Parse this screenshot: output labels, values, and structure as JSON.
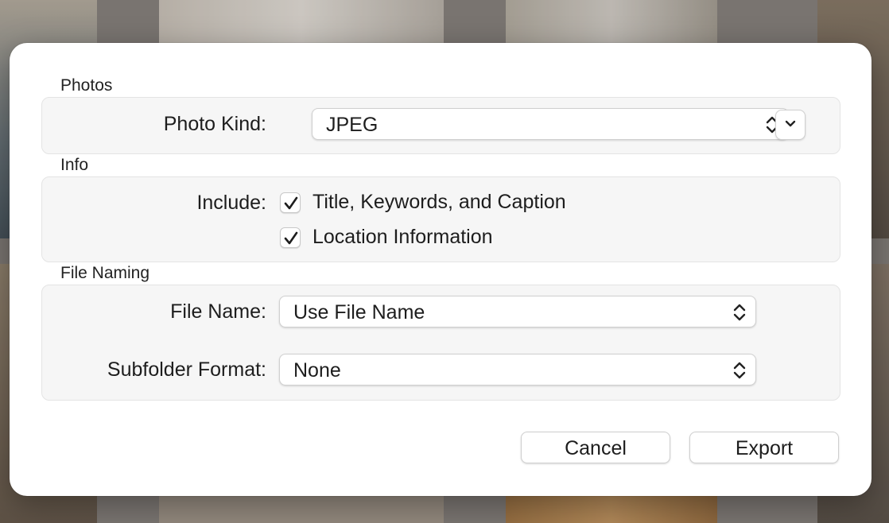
{
  "dialog": {
    "sections": {
      "photos": {
        "title": "Photos",
        "photo_kind_label": "Photo Kind:",
        "photo_kind_value": "JPEG"
      },
      "info": {
        "title": "Info",
        "include_label": "Include:",
        "options": [
          {
            "label": "Title, Keywords, and Caption",
            "checked": true
          },
          {
            "label": "Location Information",
            "checked": true
          }
        ]
      },
      "file_naming": {
        "title": "File Naming",
        "file_name_label": "File Name:",
        "file_name_value": "Use File Name",
        "subfolder_label": "Subfolder Format:",
        "subfolder_value": "None"
      }
    },
    "buttons": {
      "cancel": "Cancel",
      "export": "Export"
    }
  },
  "icons": {
    "popup_arrows": "chevron-up-down-icon",
    "disclosure": "chevron-down-icon",
    "check": "checkmark-icon"
  },
  "colors": {
    "sheet_bg": "#ffffff",
    "group_bg": "#f6f6f6",
    "text": "#1d1d1d"
  }
}
